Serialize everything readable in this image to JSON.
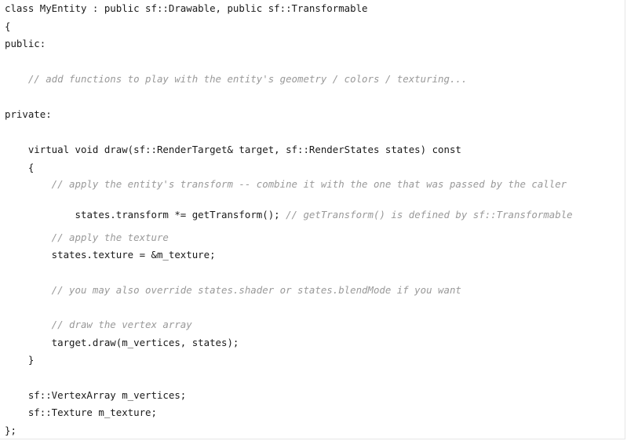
{
  "code": {
    "lines": [
      "class MyEntity : public sf::Drawable, public sf::Transformable",
      "{",
      "public:",
      "",
      "    // add functions to play with the entity's geometry / colors / texturing...",
      "",
      "private:",
      "",
      "    virtual void draw(sf::RenderTarget& target, sf::RenderStates states) const",
      "    {",
      "        // apply the entity's transform -- combine it with the one that was passed by the caller",
      "        states.transform *= getTransform();",
      " // getTransform() is defined by sf::Transformable",
      "",
      "        // apply the texture",
      "        states.texture = &m_texture;",
      "",
      "        // you may also override states.shader or states.blendMode if you want",
      "",
      "        // draw the vertex array",
      "        target.draw(m_vertices, states);",
      "    }",
      "",
      "    sf::VertexArray m_vertices;",
      "    sf::Texture m_texture;",
      "};"
    ]
  }
}
